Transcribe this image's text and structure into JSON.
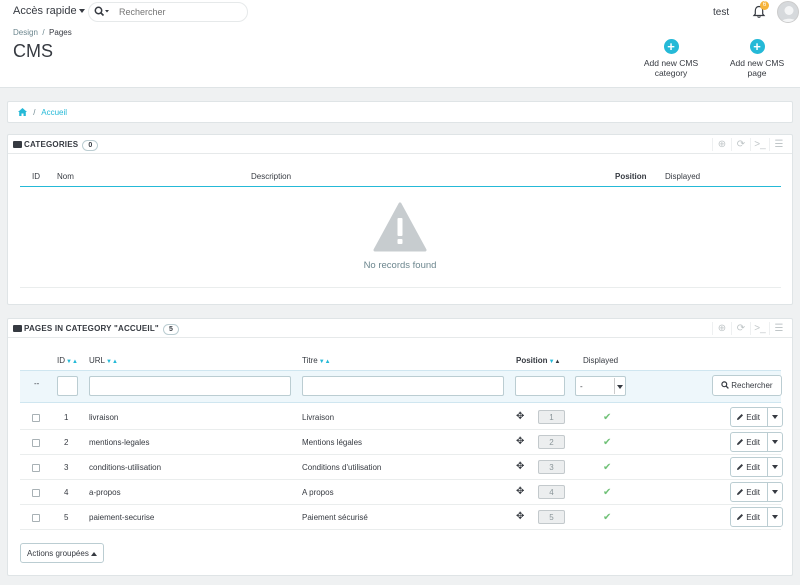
{
  "header": {
    "quick_access": "Accès rapide",
    "search_placeholder": "Rechercher",
    "user_name": "test",
    "notification_count": "6",
    "breadcrumb_parent": "Design",
    "breadcrumb_separator": "/",
    "breadcrumb_current": "Pages",
    "page_title": "CMS",
    "toolbar": {
      "add_category": "Add new CMS category",
      "add_page": "Add new CMS page"
    }
  },
  "breadcrumb": {
    "separator": "/",
    "current": "Accueil"
  },
  "categories": {
    "title": "Categories",
    "count": "0",
    "columns": [
      "ID",
      "Nom",
      "Description",
      "Position",
      "Displayed"
    ],
    "empty_text": "No records found"
  },
  "pages": {
    "title": "Pages in category \"Accueil\"",
    "count": "5",
    "columns": [
      "ID",
      "URL",
      "Titre",
      "Position",
      "Displayed"
    ],
    "filter_dash": "--",
    "displayed_filter_value": "-",
    "search_button": "Rechercher",
    "edit_label": "Edit",
    "rows": [
      {
        "id": "1",
        "url": "livraison",
        "title": "Livraison",
        "position": "1"
      },
      {
        "id": "2",
        "url": "mentions-legales",
        "title": "Mentions légales",
        "position": "2"
      },
      {
        "id": "3",
        "url": "conditions-utilisation",
        "title": "Conditions d'utilisation",
        "position": "3"
      },
      {
        "id": "4",
        "url": "a-propos",
        "title": "A propos",
        "position": "4"
      },
      {
        "id": "5",
        "url": "paiement-securise",
        "title": "Paiement sécurisé",
        "position": "5"
      }
    ],
    "bulk_actions": "Actions groupées"
  },
  "colors": {
    "accent": "#25b9d7",
    "success": "#72c279",
    "badge": "#f6b43c"
  }
}
